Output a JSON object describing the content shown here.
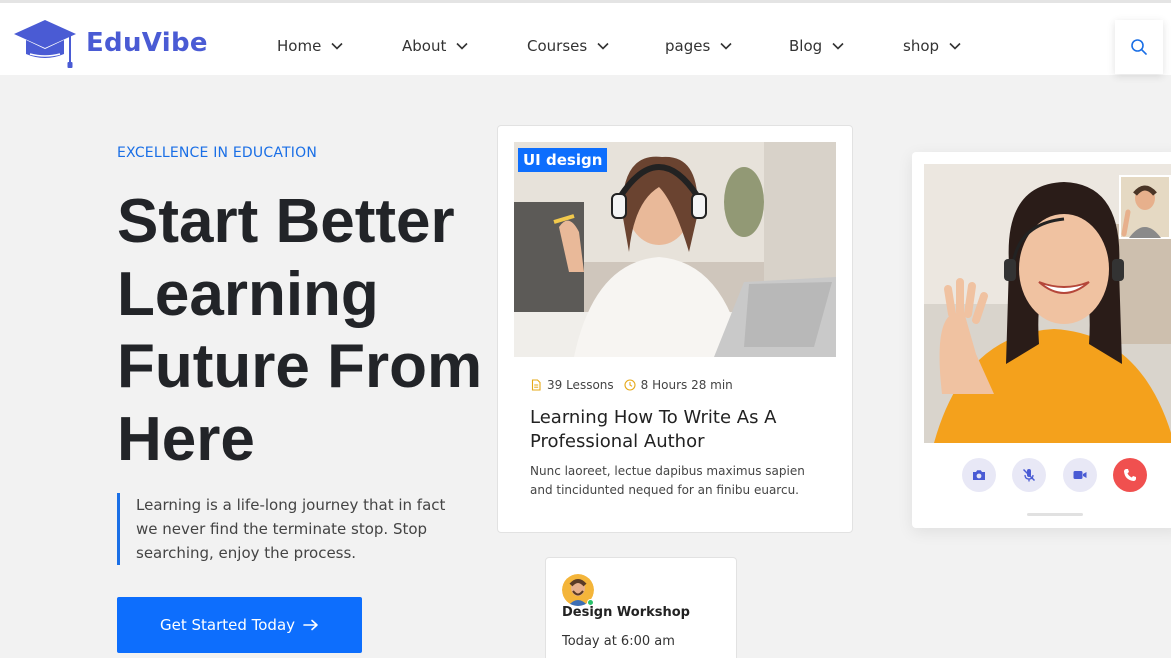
{
  "brand": {
    "name": "EduVibe",
    "logo_icon": "graduation-cap-icon",
    "color": "#4a5bd4"
  },
  "nav": {
    "items": [
      {
        "label": "Home"
      },
      {
        "label": "About"
      },
      {
        "label": "Courses"
      },
      {
        "label": "pages"
      },
      {
        "label": "Blog"
      },
      {
        "label": "shop"
      }
    ],
    "dropdown_icon": "chevron-down-icon",
    "search_icon": "search-icon"
  },
  "hero": {
    "eyebrow": "EXCELLENCE IN EDUCATION",
    "title": "Start Better Learning Future From Here",
    "quote": "Learning is a life-long journey that in fact we never find the terminate stop. Stop searching, enjoy the process.",
    "cta_label": "Get Started Today",
    "cta_icon": "arrow-right-icon",
    "accent_color": "#0d6efd"
  },
  "course_card": {
    "tag": "UI design",
    "lessons": "39 Lessons",
    "duration": "8 Hours 28 min",
    "title": "Learning How To Write As A Professional Author",
    "description": "Nunc laoreet, lectue dapibus maximus sapien and tincidunted nequed for an finibu euarcu."
  },
  "video_call": {
    "controls": [
      "camera-icon",
      "mic-off-icon",
      "video-icon",
      "phone-hangup-icon"
    ],
    "hangup_color": "#f0504f"
  },
  "event": {
    "title": "Design Workshop",
    "time": "Today at 6:00 am"
  }
}
